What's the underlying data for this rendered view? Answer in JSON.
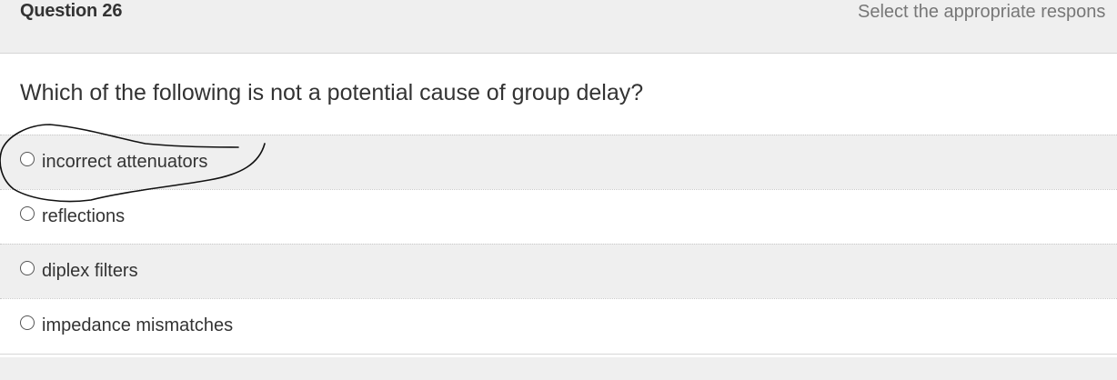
{
  "question": {
    "title": "Question 26",
    "instructions": "Select the appropriate respons",
    "prompt": "Which of the following is not a potential cause of group delay?"
  },
  "answers": [
    {
      "label": "incorrect attenuators",
      "selected": false
    },
    {
      "label": "reflections",
      "selected": false
    },
    {
      "label": "diplex filters",
      "selected": false
    },
    {
      "label": "impedance mismatches",
      "selected": false
    }
  ],
  "colors": {
    "header_bg": "#efefef",
    "text": "#333333",
    "muted_text": "#777777",
    "ink": "#111111"
  }
}
